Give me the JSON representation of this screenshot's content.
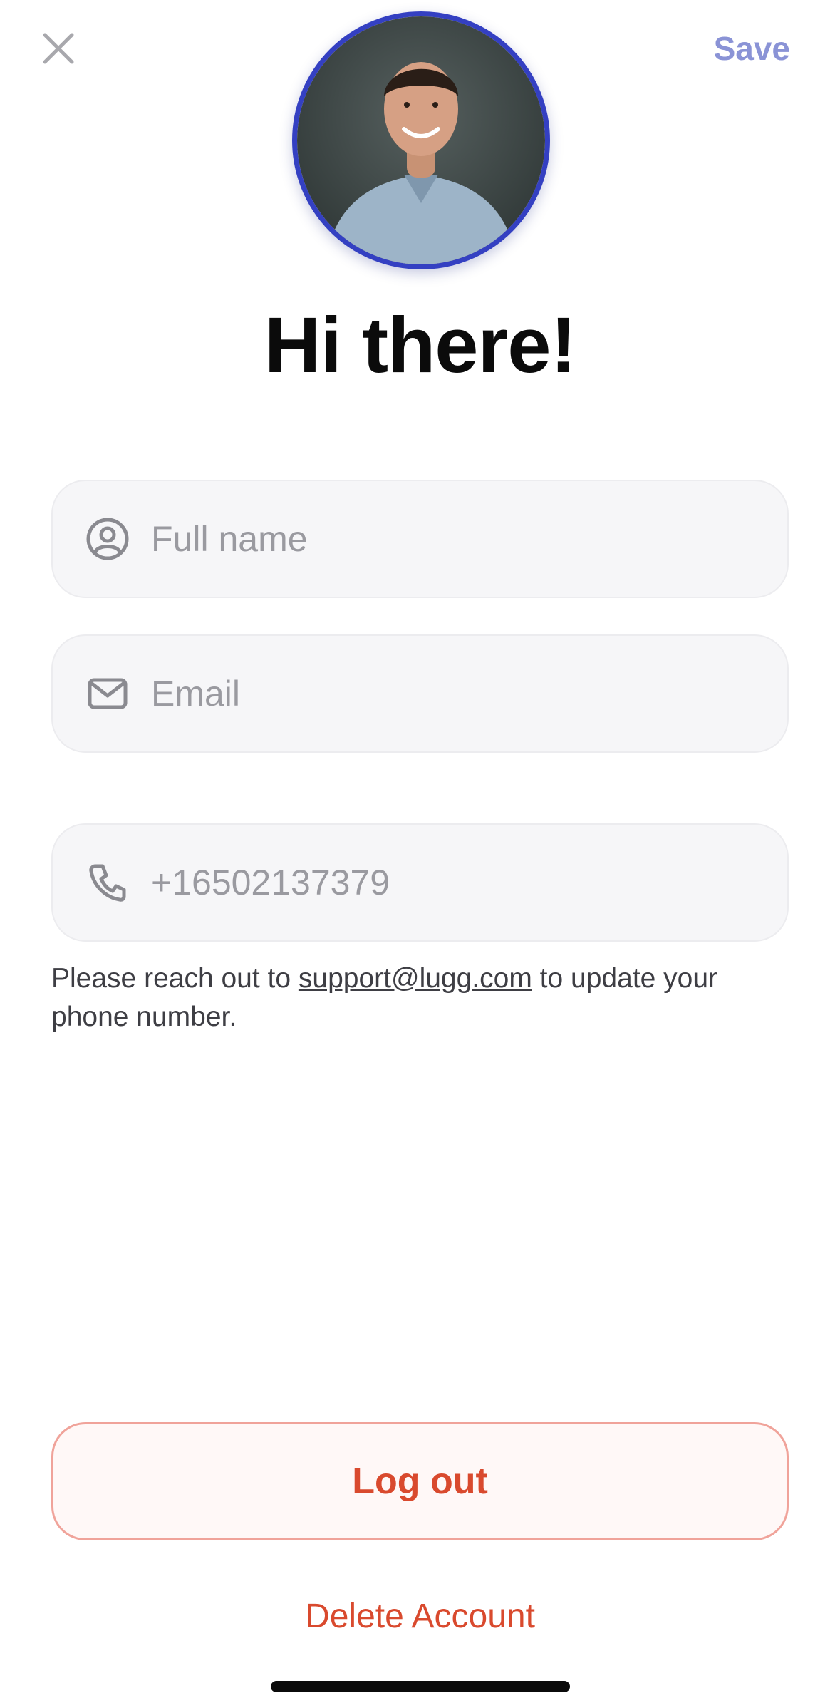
{
  "header": {
    "close_icon": "close-icon",
    "save_label": "Save",
    "accent_color": "#8a93d6"
  },
  "profile": {
    "avatar_border_color": "#3440c2",
    "greeting": "Hi there!"
  },
  "form": {
    "full_name": {
      "icon": "user-circle-icon",
      "placeholder": "Full name",
      "value": ""
    },
    "email": {
      "icon": "mail-icon",
      "placeholder": "Email",
      "value": ""
    },
    "phone": {
      "icon": "phone-icon",
      "placeholder": "+16502137379",
      "value": ""
    }
  },
  "helper": {
    "prefix": "Please reach out to ",
    "link": "support@lugg.com",
    "suffix": " to update your phone number."
  },
  "actions": {
    "logout_label": "Log out",
    "delete_label": "Delete Account",
    "danger_color": "#d94a2e"
  }
}
